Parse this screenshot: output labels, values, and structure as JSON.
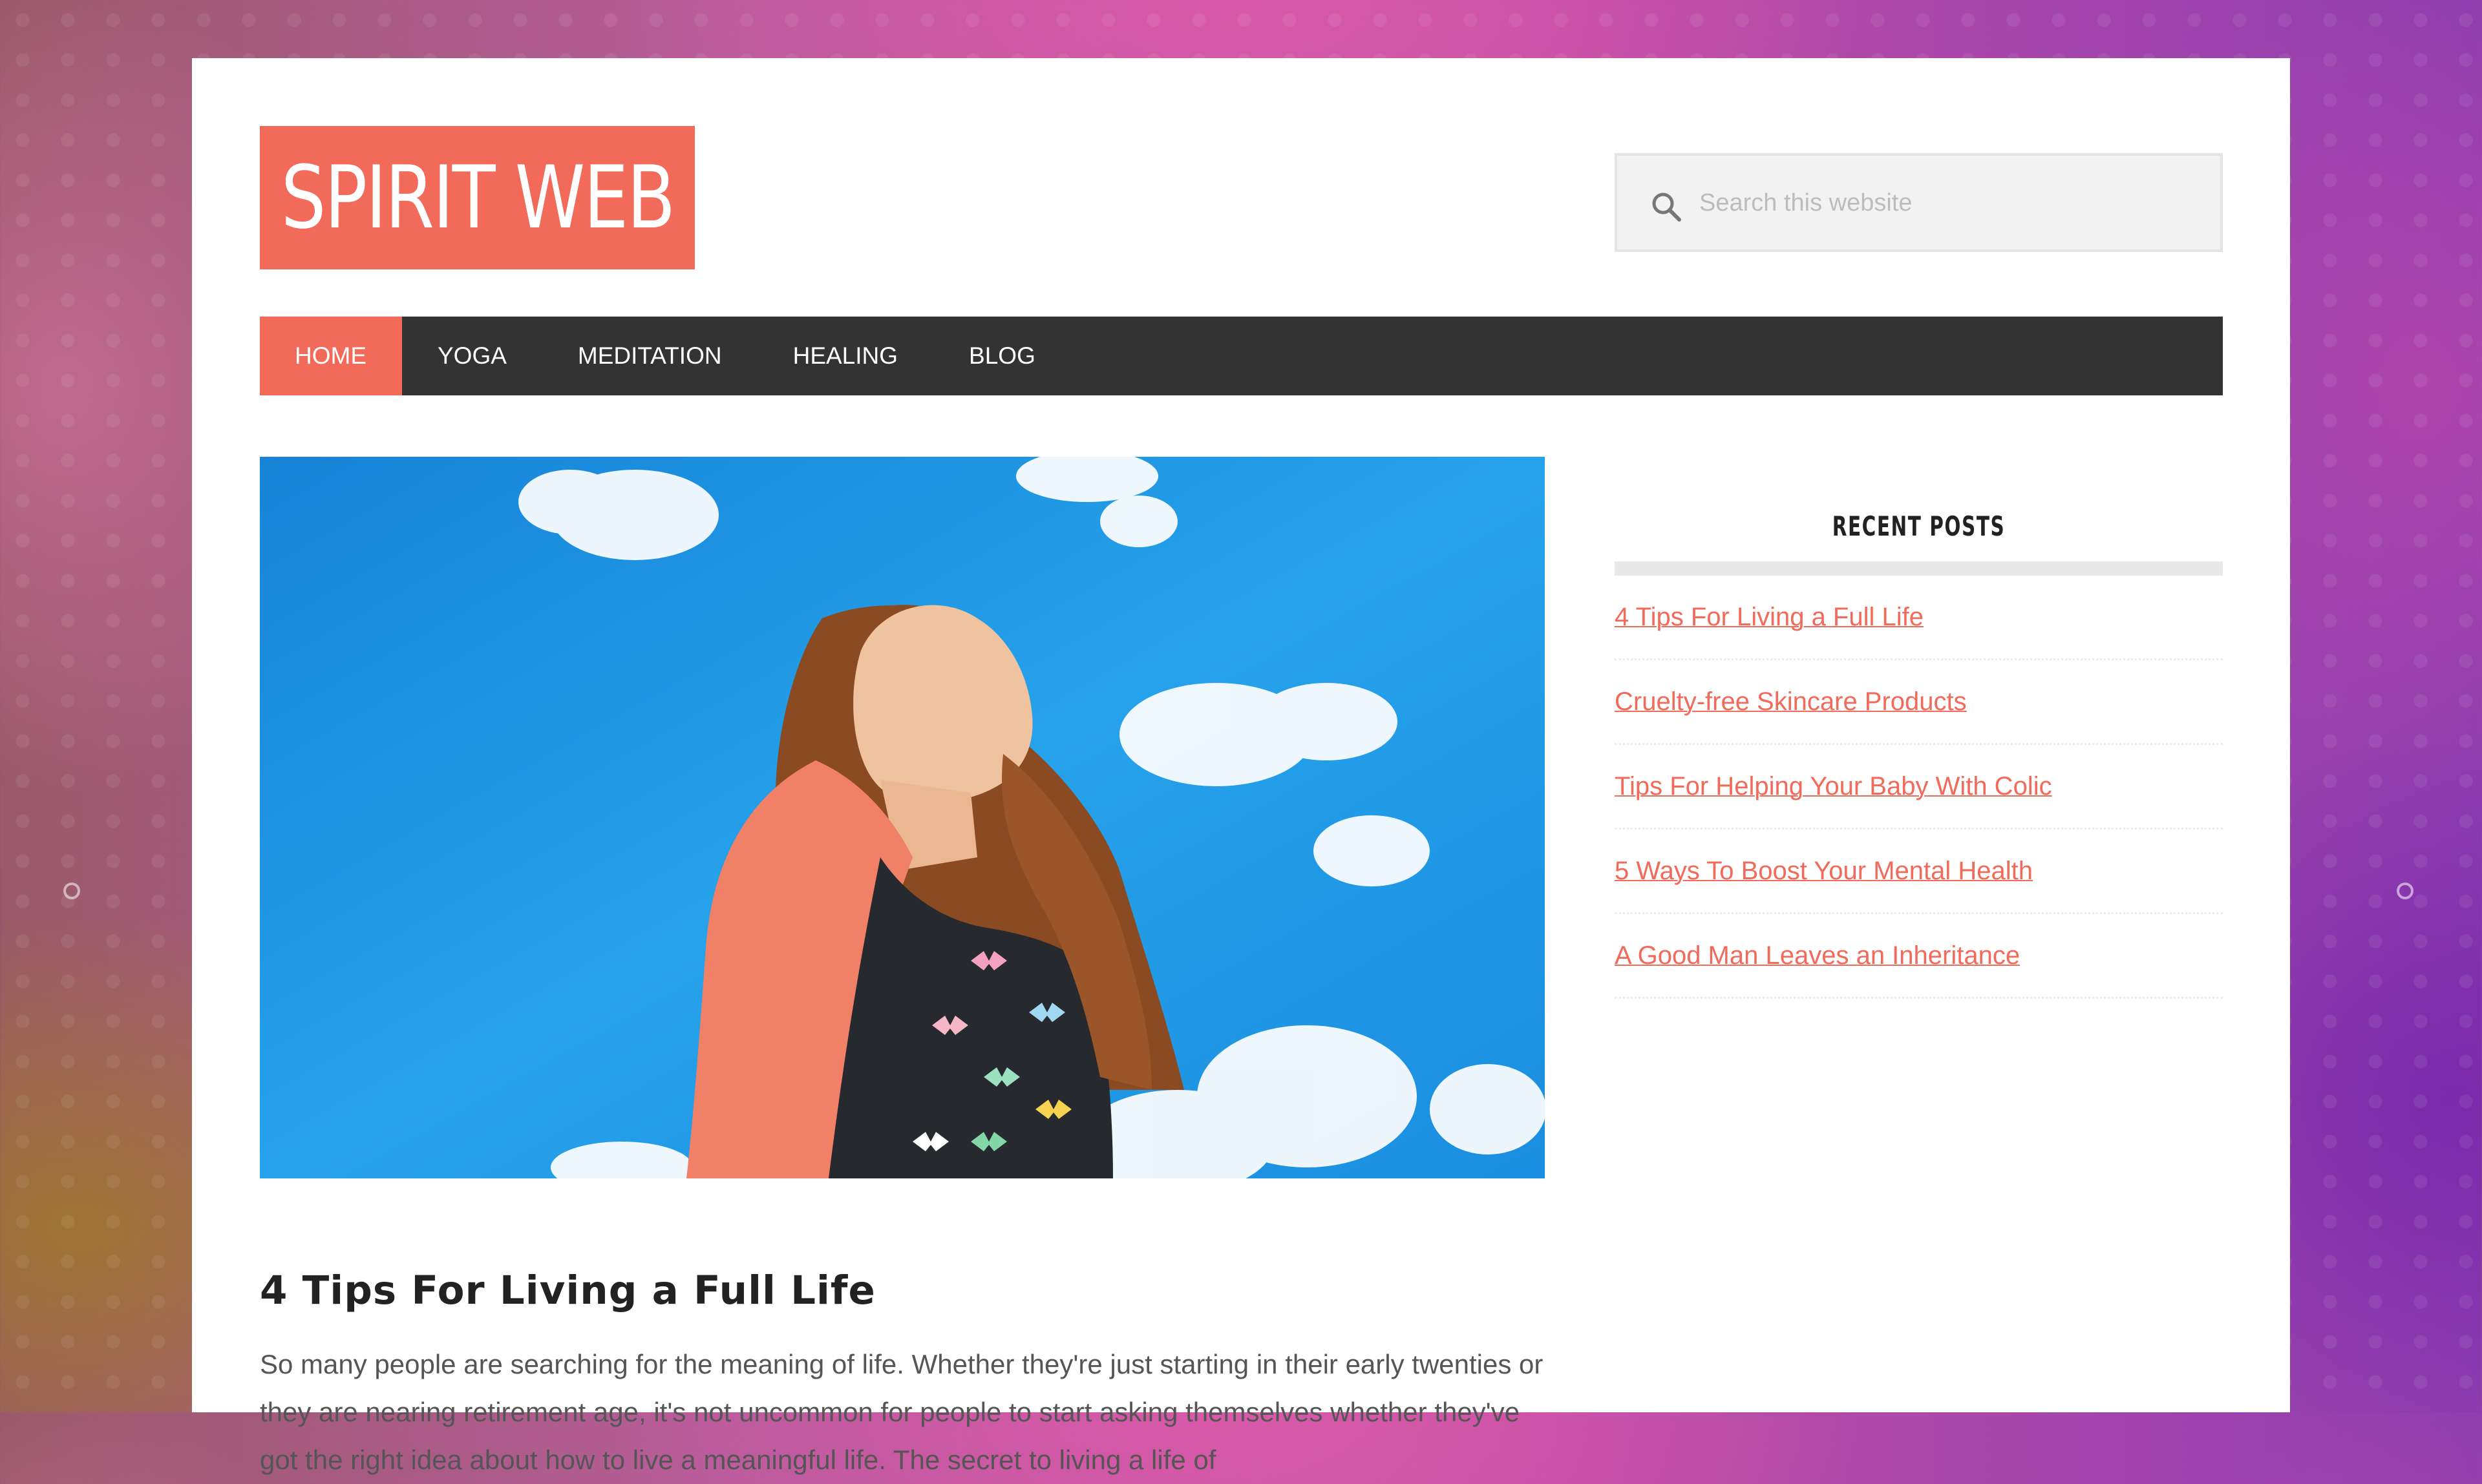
{
  "site": {
    "logo_text": "SPIRIT WEB",
    "colors": {
      "accent": "#f16a5a",
      "nav_bg": "#333333",
      "page_bg": "#ffffff"
    }
  },
  "search": {
    "placeholder": "Search this website",
    "icon": "search-icon"
  },
  "nav": {
    "items": [
      {
        "label": "HOME",
        "active": true
      },
      {
        "label": "YOGA"
      },
      {
        "label": "MEDITATION"
      },
      {
        "label": "HEALING"
      },
      {
        "label": "BLOG"
      }
    ]
  },
  "post": {
    "image_alt_subject": "woman with eyes closed under blue sky",
    "title": "4 Tips For Living a Full Life",
    "excerpt": "So many people are searching for the meaning of life. Whether they're just starting in their early twenties or they are nearing retirement age, it's not uncommon for people to start asking themselves whether they've got the right idea about how to live a meaningful life. The secret to living a life of"
  },
  "sidebar": {
    "widget_title": "RECENT POSTS",
    "recent_posts": [
      "4 Tips For Living a Full Life",
      "Cruelty-free Skincare Products",
      "Tips For Helping Your Baby With Colic",
      "5 Ways To Boost Your Mental Health",
      "A Good Man Leaves an Inheritance"
    ]
  }
}
